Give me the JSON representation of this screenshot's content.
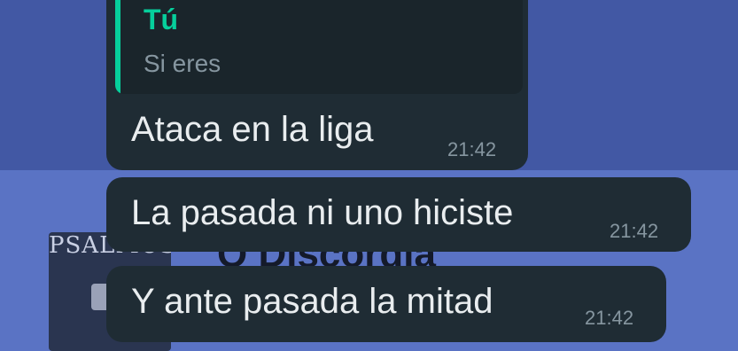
{
  "colors": {
    "chat_wallpaper": "#4258a4",
    "bubble_background": "#1f2c34",
    "quote_accent": "#06cf9c",
    "message_text": "#e9edef",
    "timestamp_text": "#8696a0"
  },
  "wallpaper": {
    "thumbnail_text": "PSALMOS",
    "caption_text": "O Discordia"
  },
  "messages": [
    {
      "quoted": {
        "author": "Tú",
        "text": "Si eres"
      },
      "text": "Ataca en la liga",
      "time": "21:42"
    },
    {
      "text": "La pasada ni uno hiciste",
      "time": "21:42"
    },
    {
      "text": "Y ante pasada la mitad",
      "time": "21:42"
    }
  ]
}
